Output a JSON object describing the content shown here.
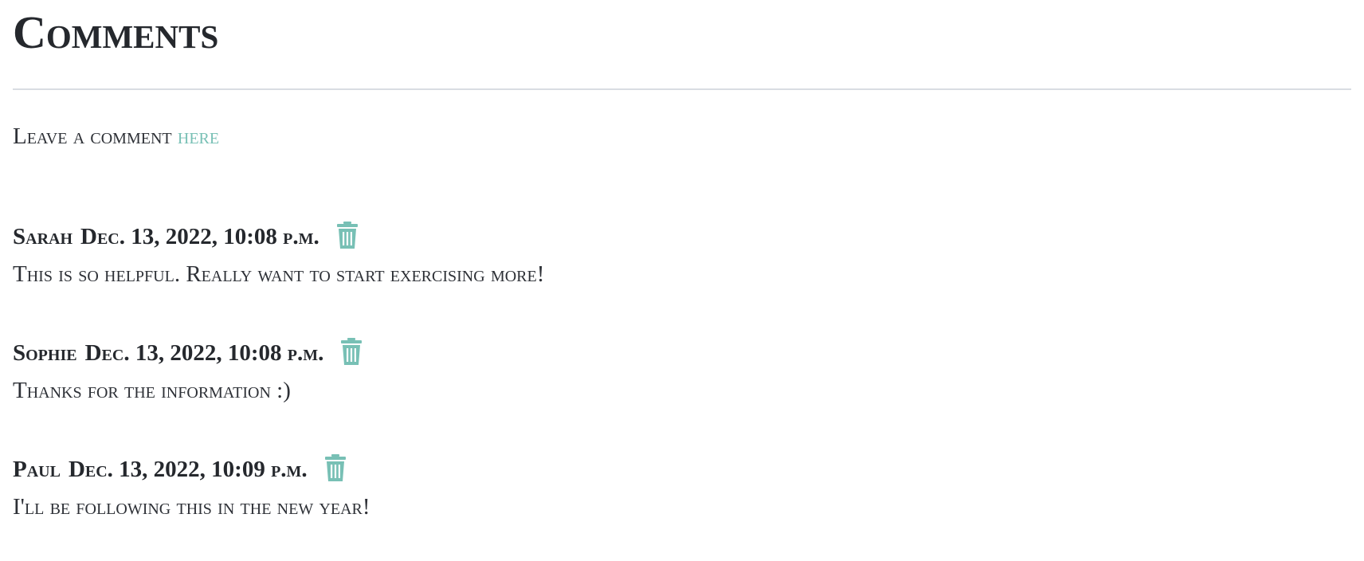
{
  "header": {
    "title": "Comments"
  },
  "leave_comment": {
    "prefix": "Leave a comment ",
    "link_text": "here"
  },
  "comments": [
    {
      "author": "Sarah",
      "timestamp": "Dec. 13, 2022, 10:08 p.m.",
      "text": "This is so helpful. Really want to start exercising more!",
      "delete_icon": "trash-icon"
    },
    {
      "author": "Sophie",
      "timestamp": "Dec. 13, 2022, 10:08 p.m.",
      "text": "Thanks for the information :)",
      "delete_icon": "trash-icon"
    },
    {
      "author": "Paul",
      "timestamp": "Dec. 13, 2022, 10:09 p.m.",
      "text": "I'll be following this in the new year!",
      "delete_icon": "trash-icon"
    }
  ],
  "colors": {
    "accent": "#78c0b5",
    "text": "#25282d",
    "divider": "#d9dde2"
  }
}
